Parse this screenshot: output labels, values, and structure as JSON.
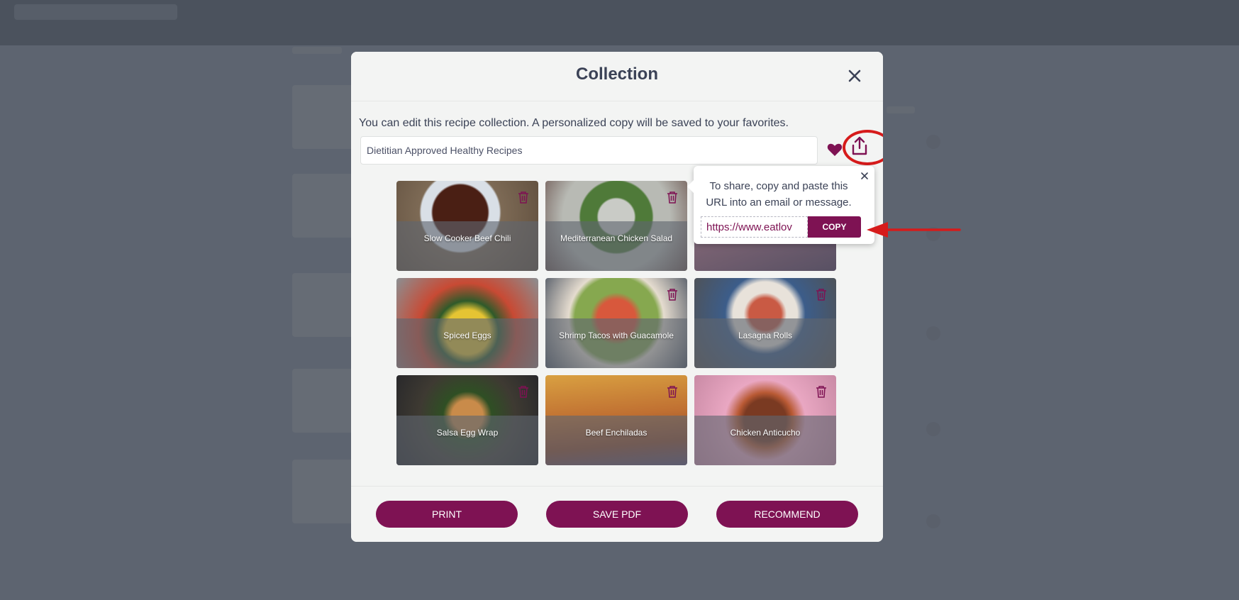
{
  "modal": {
    "title": "Collection",
    "intro": "You can edit this recipe collection. A personalized copy will be saved to your favorites.",
    "collection_name": "Dietitian Approved Healthy Recipes",
    "close_icon": "close-icon",
    "favorite_icon": "heart-icon",
    "share_icon": "share-icon"
  },
  "recipes": [
    {
      "label": "Slow Cooker Beef Chili"
    },
    {
      "label": "Mediterranean Chicken Salad"
    },
    {
      "label": ""
    },
    {
      "label": "Spiced Eggs"
    },
    {
      "label": "Shrimp Tacos with Guacamole"
    },
    {
      "label": "Lasagna Rolls"
    },
    {
      "label": "Salsa Egg Wrap"
    },
    {
      "label": "Beef Enchiladas"
    },
    {
      "label": "Chicken Anticucho"
    }
  ],
  "share_popover": {
    "message": "To share, copy and paste this URL into an email or message.",
    "url": "https://www.eatlov",
    "copy_label": "COPY"
  },
  "footer": {
    "print_label": "PRINT",
    "save_pdf_label": "SAVE PDF",
    "recommend_label": "RECOMMEND"
  },
  "colors": {
    "accent": "#7e1253",
    "annotation": "#d61b1b",
    "overlay": "#5d6470"
  }
}
